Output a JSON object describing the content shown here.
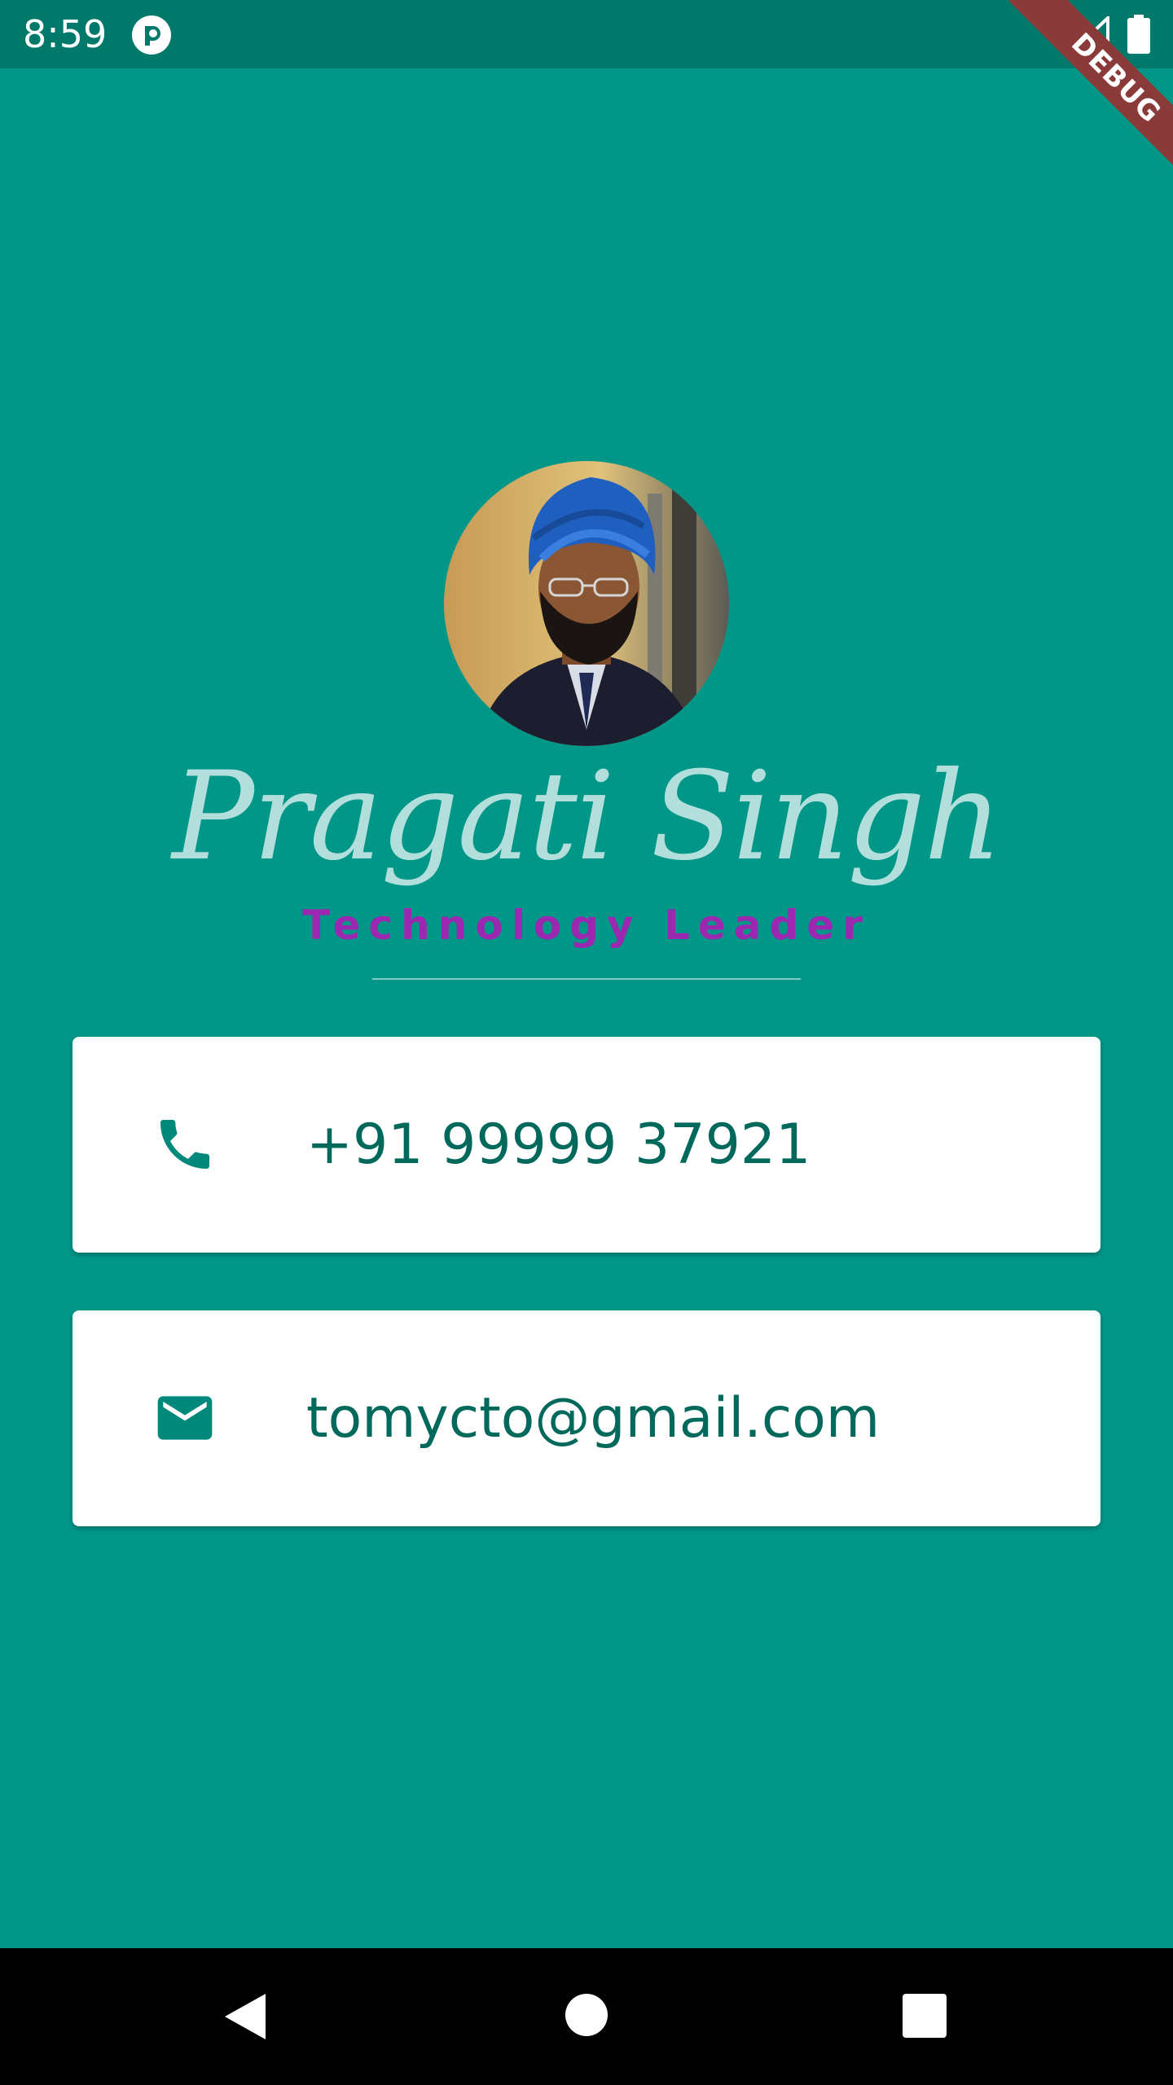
{
  "status_bar": {
    "time": "8:59",
    "icons": [
      "app-notification-icon",
      "signal-icon",
      "battery-icon"
    ]
  },
  "debug_banner": {
    "label": "DEBUG"
  },
  "profile": {
    "name": "Pragati Singh",
    "role": "Technology Leader"
  },
  "contacts": {
    "phone": {
      "icon": "phone-icon",
      "value": "+91 99999 37921"
    },
    "email": {
      "icon": "mail-icon",
      "value": "tomycto@gmail.com"
    }
  },
  "colors": {
    "background": "#009688",
    "status_bar": "#00796b",
    "name": "#b2dfdb",
    "role": "#9c27b0",
    "card_text": "#00695c",
    "icon": "#00897b"
  },
  "nav_bar": {
    "icons": [
      "back-icon",
      "home-icon",
      "recents-icon"
    ]
  }
}
